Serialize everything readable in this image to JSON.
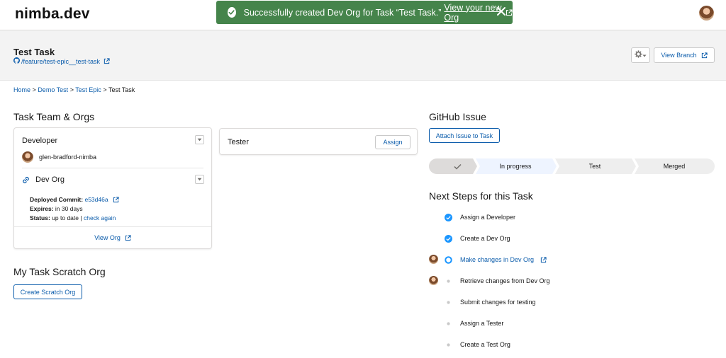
{
  "app": {
    "logo": "nimba.dev"
  },
  "toast": {
    "message": "Successfully created Dev Org for Task “Test Task.”",
    "link": "View your new Org",
    "color": "#45844b"
  },
  "header": {
    "title": "Test Task",
    "branch": "/feature/test-epic__test-task",
    "view_branch": "View Branch"
  },
  "breadcrumb": {
    "home": "Home",
    "project": "Demo Test",
    "epic": "Test Epic",
    "current": "Test Task",
    "separator": ">"
  },
  "team": {
    "title": "Task Team & Orgs",
    "developer": {
      "role": "Developer",
      "user": "glen-bradford-nimba",
      "org": {
        "name": "Dev Org",
        "commit_label": "Deployed Commit:",
        "commit": "e53d46a",
        "expires_label": "Expires:",
        "expires": "in 30 days",
        "status_label": "Status:",
        "status": "up to date",
        "status_sep": "|",
        "check_again": "check again",
        "view_org": "View Org"
      }
    },
    "tester": {
      "role": "Tester",
      "assign": "Assign"
    }
  },
  "scratch": {
    "title": "My Task Scratch Org",
    "button": "Create Scratch Org"
  },
  "github": {
    "title": "GitHub Issue",
    "button": "Attach Issue to Task"
  },
  "path": {
    "stages": [
      "In progress",
      "Test",
      "Merged"
    ],
    "complete_color": "#dddbda",
    "current_color": "#eef4ff"
  },
  "next_steps": {
    "title": "Next Steps for this Task",
    "items": [
      {
        "label": "Assign a Developer",
        "status": "complete",
        "avatar": false,
        "link": false
      },
      {
        "label": "Create a Dev Org",
        "status": "complete",
        "avatar": false,
        "link": false
      },
      {
        "label": "Make changes in Dev Org",
        "status": "active",
        "avatar": true,
        "link": true
      },
      {
        "label": "Retrieve changes from Dev Org",
        "status": "todo",
        "avatar": true,
        "link": false
      },
      {
        "label": "Submit changes for testing",
        "status": "todo",
        "avatar": false,
        "link": false
      },
      {
        "label": "Assign a Tester",
        "status": "todo",
        "avatar": false,
        "link": false
      },
      {
        "label": "Create a Test Org",
        "status": "todo",
        "avatar": false,
        "link": false
      }
    ]
  }
}
